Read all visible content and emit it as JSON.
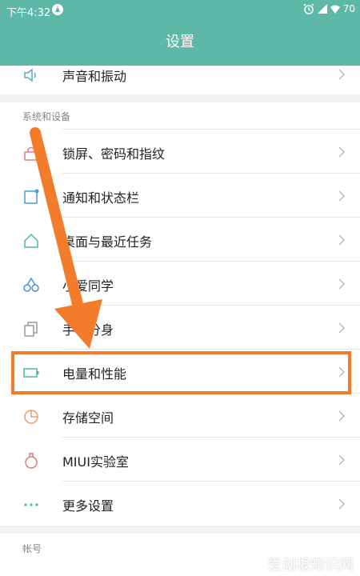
{
  "status_bar": {
    "time": "下午4:32",
    "battery": "70"
  },
  "header": {
    "title": "设置"
  },
  "top_item": {
    "label": "声音和振动"
  },
  "section_devices": {
    "title": "系统和设备",
    "items": [
      {
        "label": "锁屏、密码和指纹",
        "icon": "lock-icon"
      },
      {
        "label": "通知和状态栏",
        "icon": "notification-icon"
      },
      {
        "label": "桌面与最近任务",
        "icon": "home-icon"
      },
      {
        "label": "小爱同学",
        "icon": "ai-assistant-icon"
      },
      {
        "label": "手机分身",
        "icon": "second-space-icon"
      },
      {
        "label": "电量和性能",
        "icon": "battery-icon"
      },
      {
        "label": "存储空间",
        "icon": "storage-icon"
      },
      {
        "label": "MIUI实验室",
        "icon": "lab-icon"
      },
      {
        "label": "更多设置",
        "icon": "more-icon"
      }
    ]
  },
  "section_account": {
    "title": "帐号"
  },
  "watermark": "爱创根知识网",
  "colors": {
    "accent": "#5db8a8",
    "highlight": "#f37c2b"
  }
}
